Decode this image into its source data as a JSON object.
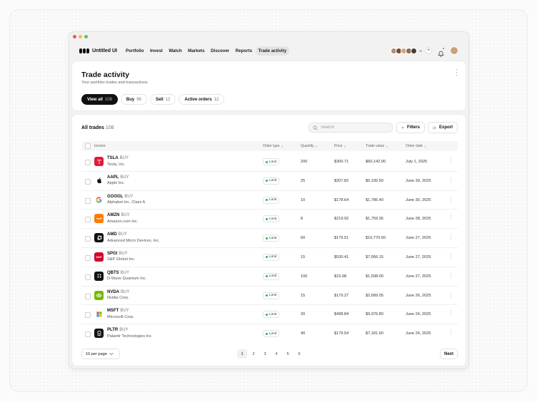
{
  "app": {
    "brand": "Untitled UI",
    "nav": [
      "Portfolio",
      "Invest",
      "Watch",
      "Markets",
      "Discover",
      "Reports",
      "Trade activity"
    ],
    "active_nav": "Trade activity",
    "avatars_more": "+5"
  },
  "header": {
    "title": "Trade activity",
    "subtitle": "Your portfolio trades and transactions.",
    "tabs": [
      {
        "label": "View all",
        "count": "108"
      },
      {
        "label": "Buy",
        "count": "96"
      },
      {
        "label": "Sell",
        "count": "12"
      },
      {
        "label": "Active orders",
        "count": "12"
      }
    ]
  },
  "table": {
    "title": "All trades",
    "count": "108",
    "search_placeholder": "Search",
    "filters_label": "Filters",
    "export_label": "Export",
    "columns": [
      "Invoice",
      "Order type",
      "Quantity",
      "Price",
      "Trade value",
      "Order date"
    ],
    "rows": [
      {
        "ticker": "TSLA",
        "side": "BUY",
        "company": "Tesla, Inc.",
        "type": "Limit",
        "qty": "200",
        "price": "$300.71",
        "value": "$60,142.00",
        "date": "July 1, 2025",
        "logo": "T",
        "logo_bg": "#e31937"
      },
      {
        "ticker": "AAPL",
        "side": "BUY",
        "company": "Apple Inc.",
        "type": "Limit",
        "qty": "25",
        "price": "$207.82",
        "value": "$5,195.50",
        "date": "June 30, 2025",
        "logo": "",
        "logo_bg": "#ffffff"
      },
      {
        "ticker": "GOOGL",
        "side": "BUY",
        "company": "Alphabet Inc. Class A",
        "type": "Limit",
        "qty": "10",
        "price": "$178.64",
        "value": "$1,786.40",
        "date": "June 30, 2025",
        "logo": "G",
        "logo_bg": "#ffffff"
      },
      {
        "ticker": "AMZN",
        "side": "BUY",
        "company": "Amazon.com Inc.",
        "type": "Limit",
        "qty": "8",
        "price": "$219.92",
        "value": "$1,759.36",
        "date": "June 28, 2025",
        "logo": "",
        "logo_bg": "#ff7a00"
      },
      {
        "ticker": "AMD",
        "side": "BUY",
        "company": "Advanced Micro Devices, Inc.",
        "type": "Limit",
        "qty": "60",
        "price": "$179.51",
        "value": "$10,770.60",
        "date": "June 27, 2025",
        "logo": "",
        "logo_bg": "#111111"
      },
      {
        "ticker": "SPGI",
        "side": "BUY",
        "company": "S&P Global Inc.",
        "type": "Limit",
        "qty": "15",
        "price": "$530.41",
        "value": "$7,956.15",
        "date": "June 27, 2025",
        "logo": "S&P",
        "logo_bg": "#d6002a"
      },
      {
        "ticker": "QBTS",
        "side": "BUY",
        "company": "D-Wave Quantum Inc.",
        "type": "Limit",
        "qty": "100",
        "price": "$15.98",
        "value": "$1,598.00",
        "date": "June 27, 2025",
        "logo": "",
        "logo_bg": "#111111"
      },
      {
        "ticker": "NVDA",
        "side": "BUY",
        "company": "Nvidia Corp.",
        "type": "Limit",
        "qty": "15",
        "price": "$179.27",
        "value": "$2,689.05",
        "date": "June 26, 2025",
        "logo": "",
        "logo_bg": "#76b900"
      },
      {
        "ticker": "MSFT",
        "side": "BUY",
        "company": "Microsoft Corp.",
        "type": "Limit",
        "qty": "20",
        "price": "$498.84",
        "value": "$9,976.80",
        "date": "June 24, 2025",
        "logo": "",
        "logo_bg": "#ffffff"
      },
      {
        "ticker": "PLTR",
        "side": "BUY",
        "company": "Palantir Technologies Inc.",
        "type": "Limit",
        "qty": "40",
        "price": "$179.54",
        "value": "$7,181.60",
        "date": "June 24, 2025",
        "logo": "",
        "logo_bg": "#111111"
      }
    ]
  },
  "pagination": {
    "per_page": "10 per page",
    "pages": [
      "1",
      "2",
      "3",
      "4",
      "5",
      "6"
    ],
    "current": "1",
    "next_label": "Next"
  }
}
